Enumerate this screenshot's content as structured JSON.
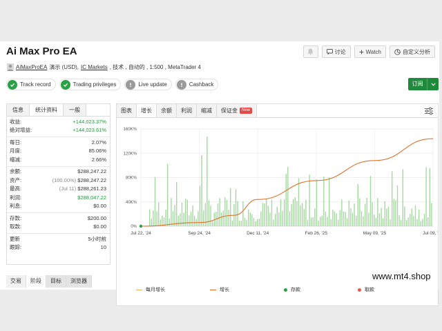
{
  "header": {
    "title": "Ai Max Pro EA",
    "buttons": {
      "discuss": "讨论",
      "watch": "Watch",
      "custom_analysis": "自定义分析"
    }
  },
  "meta": {
    "author": "AiMaxProEA",
    "account_type": "演示 (USD),",
    "broker": "IC Markets",
    "details": ", 技术 , 自动的 , 1:500 , MetaTrader 4"
  },
  "badges": [
    {
      "label": "Track record",
      "state": "ok"
    },
    {
      "label": "Trading privileges",
      "state": "ok"
    },
    {
      "label": "Live update",
      "state": "off"
    },
    {
      "label": "Cashback",
      "state": "off"
    }
  ],
  "subscribe": {
    "label": "订阅"
  },
  "stats": {
    "tabs": [
      "信息",
      "统计资料",
      "一般"
    ],
    "active_tab": 1,
    "gain": {
      "k": "收益:",
      "v": "+144,023.37%"
    },
    "abs_gain": {
      "k": "绝对增益:",
      "v": "+144,023.61%"
    },
    "daily": {
      "k": "每日:",
      "v": "2.07%"
    },
    "monthly": {
      "k": "月度:",
      "v": "85.06%"
    },
    "drawdown": {
      "k": "缩减:",
      "v": "2.66%"
    },
    "balance": {
      "k": "余额:",
      "v": "$288,247.22"
    },
    "equity": {
      "k": "资产:",
      "pct": "(100.00%)",
      "v": "$288,247.22"
    },
    "highest": {
      "k": "最高:",
      "date": "(Jul 11)",
      "v": "$288,261.23"
    },
    "profit": {
      "k": "利润:",
      "v": "$288,047.22"
    },
    "interest": {
      "k": "利息:",
      "v": "$0.00"
    },
    "deposits": {
      "k": "存款:",
      "v": "$200.00"
    },
    "withdrawals": {
      "k": "取款:",
      "v": "$0.00"
    },
    "updated": {
      "k": "更新",
      "v": "5小时前"
    },
    "tracking": {
      "k": "跟踪:",
      "v": "10"
    }
  },
  "chart_tabs": [
    {
      "label": "图表"
    },
    {
      "label": "增长"
    },
    {
      "label": "余额"
    },
    {
      "label": "利润"
    },
    {
      "label": "缩减"
    },
    {
      "label": "保证金",
      "badge": "New"
    }
  ],
  "chart_active_tab": 1,
  "chart_data": {
    "type": "line",
    "x_ticks": [
      "Jul 22, '24",
      "Sep 24, '24",
      "Dec 11, '24",
      "Feb 26, '25",
      "May 09, '25",
      "Jul 09, '25"
    ],
    "y_ticks": [
      "0%",
      "40K%",
      "80K%",
      "120K%",
      "160K%"
    ],
    "ylim": [
      0,
      160000
    ],
    "grid": true,
    "legend_position": "bottom",
    "series": [
      {
        "name": "每月增长",
        "style": "bars",
        "color": "#a5d9a0"
      },
      {
        "name": "增长",
        "style": "line",
        "color": "#e0712c",
        "x": [
          "Jul 22, '24",
          "Sep 24, '24",
          "Nov 10, '24",
          "Dec 11, '24",
          "Feb 26, '25",
          "May 09, '25",
          "Jul 09, '25"
        ],
        "values": [
          0,
          6000,
          18000,
          44000,
          75000,
          108000,
          144023
        ]
      },
      {
        "name": "存款",
        "style": "marker",
        "color": "#2aa144"
      },
      {
        "name": "取款",
        "style": "marker",
        "color": "#e25b4a"
      }
    ]
  },
  "bottom_tabs": [
    "交易",
    "阶段",
    "目标",
    "浏览器"
  ],
  "bottom_active_tab": 1,
  "watermark": "www.mt4.shop",
  "colors": {
    "accent_green": "#1f8a3b",
    "growth_line": "#e0712c",
    "bars": "#a5d9a0",
    "gain_text": "#1e9a3c"
  },
  "icons": [
    "bell-icon",
    "chat-icon",
    "plus-icon",
    "chart-analysis-icon",
    "user-icon",
    "check-icon",
    "exclamation-icon",
    "settings-icon"
  ]
}
